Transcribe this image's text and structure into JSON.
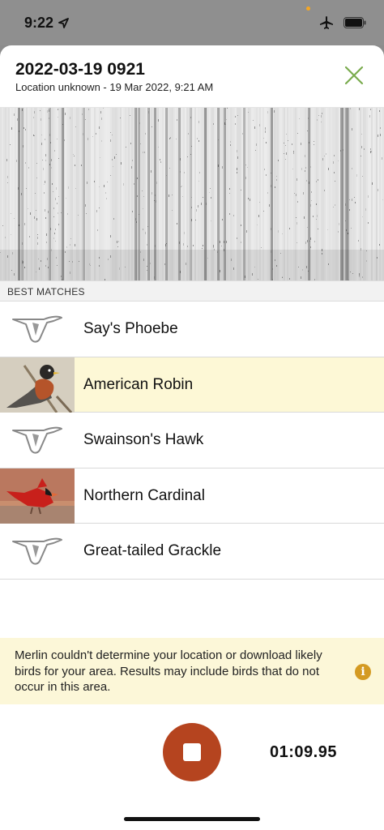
{
  "status_bar": {
    "time": "9:22",
    "location_icon": "location-arrow-icon",
    "airplane_icon": "airplane-icon",
    "battery_icon": "battery-icon"
  },
  "header": {
    "title": "2022-03-19 0921",
    "subtitle": "Location unknown - 19 Mar 2022, 9:21 AM",
    "close_icon": "close-icon",
    "accent_color": "#7aab4e"
  },
  "spectrogram": {
    "icon": "spectrogram-image"
  },
  "matches": {
    "section_label": "BEST MATCHES",
    "items": [
      {
        "name": "Say's Phoebe",
        "thumbnail": "bird-placeholder-icon",
        "highlighted": false
      },
      {
        "name": "American Robin",
        "thumbnail": "american-robin-photo",
        "highlighted": true
      },
      {
        "name": "Swainson's Hawk",
        "thumbnail": "bird-placeholder-icon",
        "highlighted": false
      },
      {
        "name": "Northern Cardinal",
        "thumbnail": "northern-cardinal-photo",
        "highlighted": false
      },
      {
        "name": "Great-tailed Grackle",
        "thumbnail": "bird-placeholder-icon",
        "highlighted": false
      }
    ]
  },
  "notice": {
    "text": "Merlin couldn't determine your location or download likely birds for your area. Results may include birds that do not occur in this area.",
    "icon": "info-icon",
    "icon_glyph": "i",
    "icon_color": "#d49a22"
  },
  "recording": {
    "stop_icon": "stop-icon",
    "button_color": "#b5441f",
    "elapsed": "01:09.95"
  }
}
